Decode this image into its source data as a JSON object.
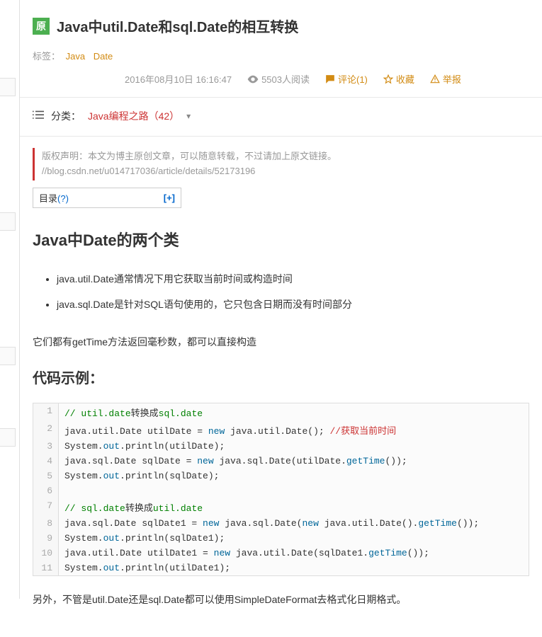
{
  "badge": "原",
  "title": "Java中util.Date和sql.Date的相互转换",
  "tags": {
    "label": "标签：",
    "items": [
      "Java",
      "Date"
    ]
  },
  "meta": {
    "date": "2016年08月10日 16:16:47",
    "reads": "5503人阅读",
    "comments": "评论(1)",
    "fav": "收藏",
    "report": "举报"
  },
  "category": {
    "label": "分类：",
    "value": "Java编程之路（42）"
  },
  "copyright": "版权声明：本文为博主原创文章，可以随意转载，不过请加上原文链接。  //blog.csdn.net/u014717036/article/details/52173196",
  "toc": {
    "label": "目录",
    "q": "(?)",
    "expand": "[+]"
  },
  "h1": "Java中Date的两个类",
  "bullets": [
    "java.util.Date通常情况下用它获取当前时间或构造时间",
    "java.sql.Date是针对SQL语句使用的，它只包含日期而没有时间部分"
  ],
  "para1": "它们都有getTime方法返回毫秒数，都可以直接构造",
  "h2": "代码示例：",
  "code": {
    "l1_a": "// util.date",
    "l1_b": "转换成",
    "l1_c": "sql.date",
    "l2_a": "java.util.Date utilDate = ",
    "l2_new": "new",
    "l2_b": " java.util.Date(); ",
    "l2_c": "//获取当前时间",
    "l3_a": "System.",
    "l3_out": "out",
    "l3_b": ".println(utilDate);",
    "l4_a": "java.sql.Date sqlDate = ",
    "l4_new": "new",
    "l4_b": " java.sql.Date(utilDate.",
    "l4_gt": "getTime",
    "l4_c": "());",
    "l5_a": "System.",
    "l5_out": "out",
    "l5_b": ".println(sqlDate);",
    "l7_a": "// sql.date",
    "l7_b": "转换成",
    "l7_c": "util.date",
    "l8_a": "java.sql.Date sqlDate1 = ",
    "l8_new": "new",
    "l8_b": " java.sql.Date(",
    "l8_new2": "new",
    "l8_c": " java.util.Date().",
    "l8_gt": "getTime",
    "l8_d": "());",
    "l9_a": "System.",
    "l9_out": "out",
    "l9_b": ".println(sqlDate1);",
    "l10_a": "java.util.Date utilDate1 = ",
    "l10_new": "new",
    "l10_b": " java.util.Date(sqlDate1.",
    "l10_gt": "getTime",
    "l10_c": "());",
    "l11_a": "System.",
    "l11_out": "out",
    "l11_b": ".println(utilDate1);"
  },
  "para2": "另外，不管是util.Date还是sql.Date都可以使用SimpleDateFormat去格式化日期格式。"
}
